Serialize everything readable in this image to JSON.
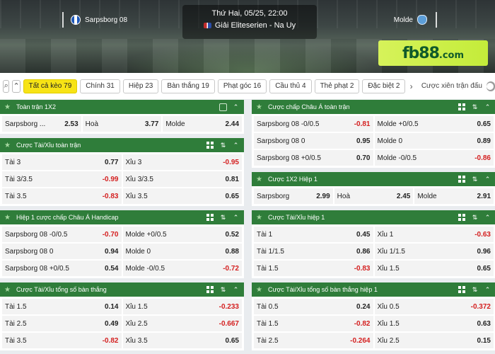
{
  "header": {
    "home_team": "Sarpsborg 08",
    "away_team": "Molde",
    "datetime": "Thứ Hai, 05/25, 22:00",
    "league": "Giải Eliteserien - Na Uy",
    "logo_main": "fb88",
    "logo_suffix": ".com"
  },
  "tabs": {
    "icons": [
      "search-icon",
      "chevrons-up-icon"
    ],
    "items": [
      {
        "label": "Tất cả kèo 79",
        "active": true
      },
      {
        "label": "Chính 31"
      },
      {
        "label": "Hiệp 23"
      },
      {
        "label": "Bàn thắng 19"
      },
      {
        "label": "Phạt góc 16"
      },
      {
        "label": "Cầu thủ 4"
      },
      {
        "label": "Thẻ phạt 2"
      },
      {
        "label": "Đặc biệt 2"
      }
    ],
    "combo_label": "Cược xiên trận đấu"
  },
  "markets_left": [
    {
      "title": "Toàn trận 1X2",
      "tv": true,
      "rows": [
        [
          {
            "l": "Sarpsborg ...",
            "o": "2.53"
          },
          {
            "l": "Hoà",
            "o": "3.77"
          },
          {
            "l": "Molde",
            "o": "2.44"
          }
        ]
      ]
    },
    {
      "title": "Cược Tài/Xỉu toàn trận",
      "rows": [
        [
          {
            "l": "Tài 3",
            "o": "0.77"
          },
          {
            "l": "Xỉu 3",
            "o": "-0.95"
          }
        ],
        [
          {
            "l": "Tài 3/3.5",
            "o": "-0.99"
          },
          {
            "l": "Xỉu 3/3.5",
            "o": "0.81"
          }
        ],
        [
          {
            "l": "Tài 3.5",
            "o": "-0.83"
          },
          {
            "l": "Xỉu 3.5",
            "o": "0.65"
          }
        ]
      ]
    },
    {
      "title": "Hiệp 1 cược chấp Châu Á Handicap",
      "rows": [
        [
          {
            "l": "Sarpsborg 08 -0/0.5",
            "o": "-0.70"
          },
          {
            "l": "Molde +0/0.5",
            "o": "0.52"
          }
        ],
        [
          {
            "l": "Sarpsborg 08 0",
            "o": "0.94"
          },
          {
            "l": "Molde 0",
            "o": "0.88"
          }
        ],
        [
          {
            "l": "Sarpsborg 08 +0/0.5",
            "o": "0.54"
          },
          {
            "l": "Molde -0/0.5",
            "o": "-0.72"
          }
        ]
      ]
    },
    {
      "title": "Cược Tài/Xỉu tổng số bàn thắng",
      "rows": [
        [
          {
            "l": "Tài 1.5",
            "o": "0.14"
          },
          {
            "l": "Xỉu 1.5",
            "o": "-0.233"
          }
        ],
        [
          {
            "l": "Tài 2.5",
            "o": "0.49"
          },
          {
            "l": "Xỉu 2.5",
            "o": "-0.667"
          }
        ],
        [
          {
            "l": "Tài 3.5",
            "o": "-0.82"
          },
          {
            "l": "Xỉu 3.5",
            "o": "0.65"
          }
        ]
      ]
    }
  ],
  "markets_right": [
    {
      "title": "Cược chấp Châu Á toàn trận",
      "rows": [
        [
          {
            "l": "Sarpsborg 08 -0/0.5",
            "o": "-0.81"
          },
          {
            "l": "Molde +0/0.5",
            "o": "0.65"
          }
        ],
        [
          {
            "l": "Sarpsborg 08 0",
            "o": "0.95"
          },
          {
            "l": "Molde 0",
            "o": "0.89"
          }
        ],
        [
          {
            "l": "Sarpsborg 08 +0/0.5",
            "o": "0.70"
          },
          {
            "l": "Molde -0/0.5",
            "o": "-0.86"
          }
        ]
      ]
    },
    {
      "title": "Cược 1X2 Hiệp 1",
      "rows": [
        [
          {
            "l": "Sarpsborg",
            "o": "2.99"
          },
          {
            "l": "Hoà",
            "o": "2.45"
          },
          {
            "l": "Molde",
            "o": "2.91"
          }
        ]
      ]
    },
    {
      "title": "Cược Tài/Xỉu hiệp 1",
      "rows": [
        [
          {
            "l": "Tài 1",
            "o": "0.45"
          },
          {
            "l": "Xỉu 1",
            "o": "-0.63"
          }
        ],
        [
          {
            "l": "Tài 1/1.5",
            "o": "0.86"
          },
          {
            "l": "Xỉu 1/1.5",
            "o": "0.96"
          }
        ],
        [
          {
            "l": "Tài 1.5",
            "o": "-0.83"
          },
          {
            "l": "Xỉu 1.5",
            "o": "0.65"
          }
        ]
      ]
    },
    {
      "title": "Cược Tài/Xỉu tổng số bàn thắng hiệp 1",
      "rows": [
        [
          {
            "l": "Tài 0.5",
            "o": "0.24"
          },
          {
            "l": "Xỉu 0.5",
            "o": "-0.372"
          }
        ],
        [
          {
            "l": "Tài 1.5",
            "o": "-0.82"
          },
          {
            "l": "Xỉu 1.5",
            "o": "0.63"
          }
        ],
        [
          {
            "l": "Tài 2.5",
            "o": "-0.264"
          },
          {
            "l": "Xỉu 2.5",
            "o": "0.15"
          }
        ]
      ]
    }
  ],
  "colors": {
    "accent_green": "#2f7d3a",
    "active_tab": "#f7e316",
    "negative_odd": "#d42020"
  }
}
